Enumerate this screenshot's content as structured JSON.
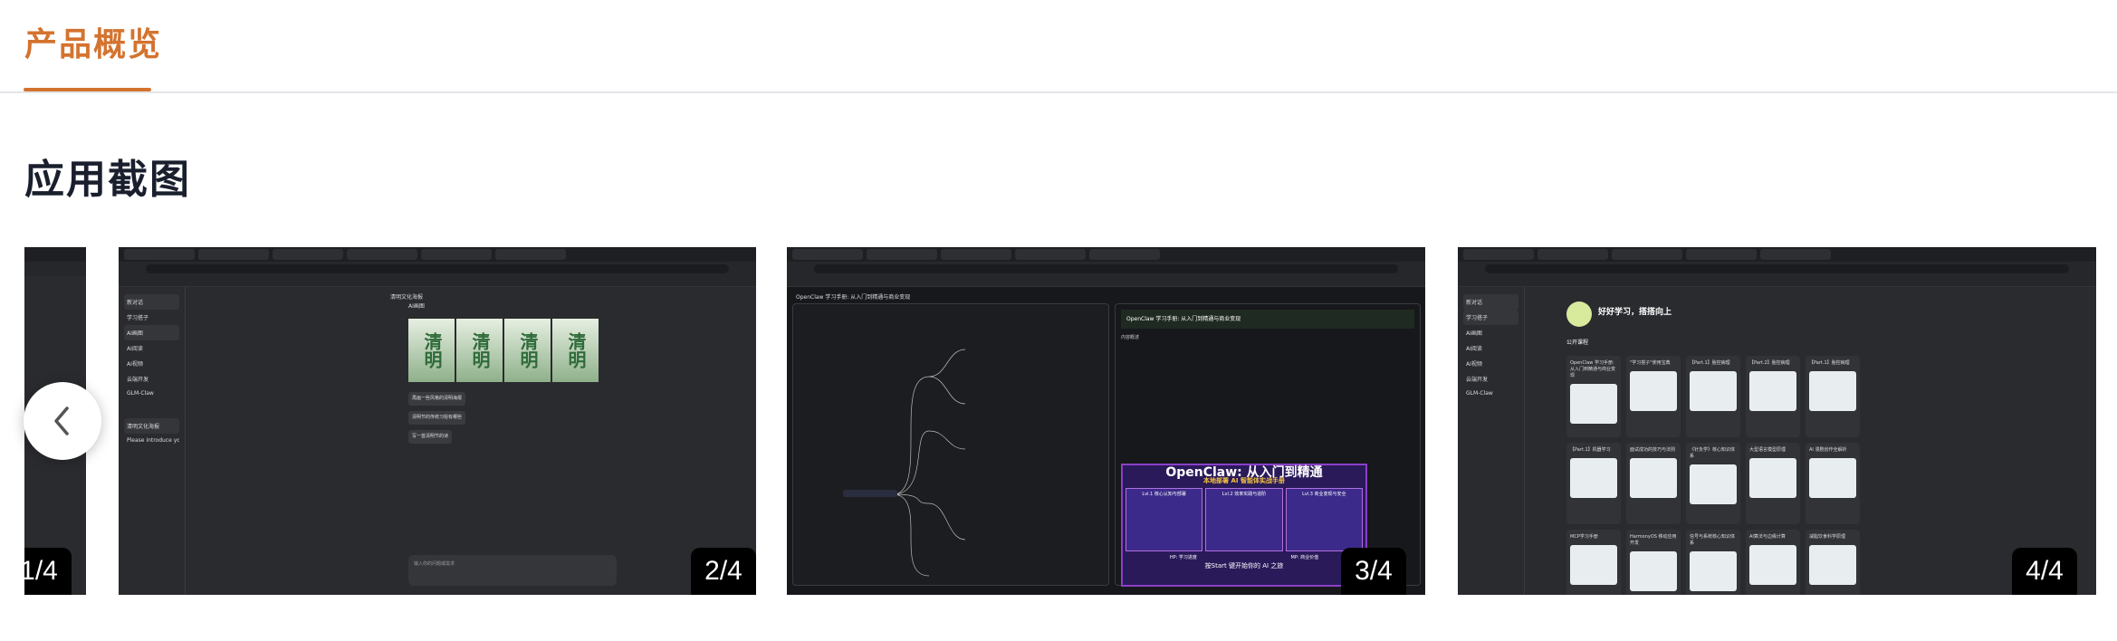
{
  "header": {
    "tab_label": "产品概览",
    "section_title": "应用截图"
  },
  "carousel": {
    "prev_icon": "chevron-left-icon",
    "slides": [
      {
        "counter": "1/4"
      },
      {
        "counter": "2/4",
        "sidebar": [
          "新对话",
          "学习搭子",
          "AI画图",
          "AI阅读",
          "AI视频",
          "云端开发",
          "GLM-Claw"
        ],
        "history": [
          "清明文化海报",
          "Please introduce yourself in ..."
        ],
        "title": "清明文化海报",
        "assistant": "AI画图",
        "poster_text": [
          "清明",
          "清明",
          "清明",
          "清明"
        ],
        "suggestions": [
          "再画一些风格的清明海报",
          "清明节的传统习俗有哪些",
          "写一首清明节的诗"
        ],
        "input_placeholder": "输入你的问题或需求"
      },
      {
        "counter": "3/4",
        "header": "OpenClaw 学习手册: 从入门到精通与商业变现",
        "card_title": "OpenClaw 学习手册: 从入门到精通与商业变现",
        "section_overview": "内容概述",
        "poster": {
          "title": "OpenClaw: 从入门到精通",
          "subtitle": "本地部署 AI 智能体实战手册",
          "levels": [
            "Lvl.1 核心认知与部署",
            "Lvl.2 效率实践与进阶",
            "Lvl.3 商业变现与安全"
          ],
          "hp": "HP: 学习进度",
          "mp": "MP: 商业价值",
          "start": "按Start 键开始你的 AI 之旅"
        }
      },
      {
        "counter": "4/4",
        "sidebar": [
          "新对话",
          "学习搭子",
          "AI画图",
          "AI阅读",
          "AI视频",
          "云端开发",
          "GLM-Claw"
        ],
        "hero": "好好学习，搭搭向上",
        "public_label": "公开课程",
        "cards": [
          "OpenClaw 学习手册: 从入门到精通与商业变现",
          "\"学习搭子\"使用宝典",
          "【Part.1】胎控病理",
          "【Part.2】胎控病理",
          "【Part.1】胎控病理",
          "【Part.1】机器学习",
          "面试成功的技巧与法则",
          "《针灸学》核心知识体系",
          "大型语言模型原理",
          "AI 漫剧创作全解析",
          "MCP学习手册",
          "HarmonyOS 移动应用开发",
          "信号与系统核心知识体系",
          "AI算法与边缘计算",
          "减脂饮食科学原理"
        ]
      }
    ]
  }
}
